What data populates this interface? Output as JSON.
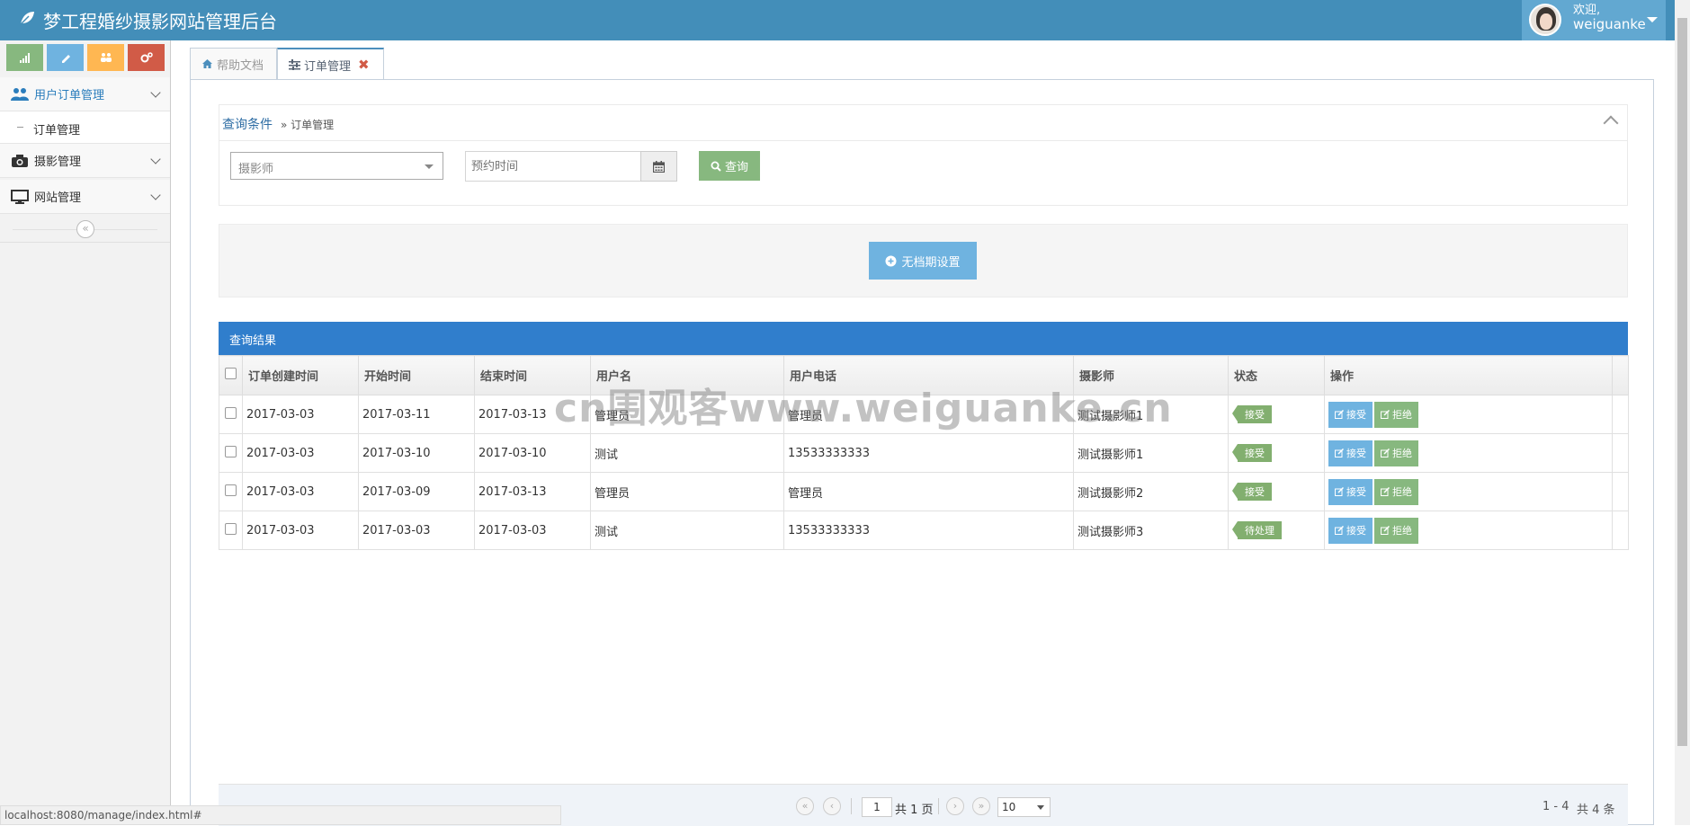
{
  "header": {
    "title": "梦工程婚纱摄影网站管理后台",
    "welcome": "欢迎,",
    "username": "weiguanke"
  },
  "sidebar": {
    "shortcut_colors": [
      "#87b87f",
      "#6fb3e0",
      "#ffb752",
      "#d15b47"
    ],
    "items": [
      {
        "label": "用户订单管理",
        "icon": "users-icon"
      },
      {
        "label": "订单管理",
        "icon": "dash"
      },
      {
        "label": "摄影管理",
        "icon": "camera-icon"
      },
      {
        "label": "网站管理",
        "icon": "desktop-icon"
      }
    ]
  },
  "tabs": [
    {
      "label": "帮助文档",
      "icon": "home-icon"
    },
    {
      "label": "订单管理",
      "icon": "sliders-icon"
    }
  ],
  "query": {
    "title": "查询条件",
    "crumb": "» 订单管理",
    "photographer_placeholder": "摄影师",
    "date_placeholder": "预约时间",
    "search_label": "查询"
  },
  "no_file_button": "无档期设置",
  "results": {
    "title": "查询结果",
    "columns": [
      "订单创建时间",
      "开始时间",
      "结束时间",
      "用户名",
      "用户电话",
      "摄影师",
      "状态",
      "操作"
    ],
    "accept_label": "接受",
    "reject_label": "拒绝",
    "rows": [
      [
        "2017-03-03",
        "2017-03-11",
        "2017-03-13",
        "管理员",
        "管理员",
        "测试摄影师1",
        "接受"
      ],
      [
        "2017-03-03",
        "2017-03-10",
        "2017-03-10",
        "测试",
        "13533333333",
        "测试摄影师1",
        "接受"
      ],
      [
        "2017-03-03",
        "2017-03-09",
        "2017-03-13",
        "管理员",
        "管理员",
        "测试摄影师2",
        "接受"
      ],
      [
        "2017-03-03",
        "2017-03-03",
        "2017-03-03",
        "测试",
        "13533333333",
        "测试摄影师3",
        "待处理"
      ]
    ]
  },
  "pager": {
    "page": "1",
    "total_pages": "共 1 页",
    "page_size": "10",
    "range": "1 - 4",
    "total": "共 4 条"
  },
  "watermark": "cn围观客www.weiguanke.cn",
  "status_url": "localhost:8080/manage/index.html#"
}
